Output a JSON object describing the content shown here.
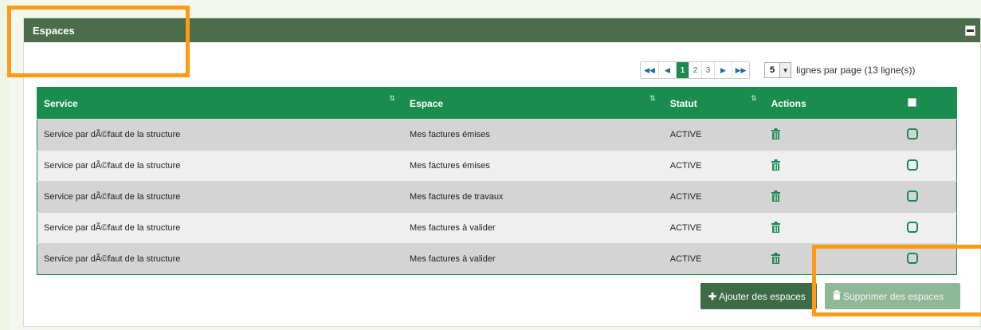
{
  "panel": {
    "title": "Espaces"
  },
  "pagination": {
    "first": "⏮",
    "prev": "◀",
    "pages": [
      "1",
      "2",
      "3"
    ],
    "active_page": "1",
    "next": "▶",
    "last": "⏭",
    "per_page_value": "5",
    "per_page_text": "lignes par page (13 ligne(s))"
  },
  "table": {
    "headers": {
      "service": "Service",
      "espace": "Espace",
      "statut": "Statut",
      "actions": "Actions"
    },
    "rows": [
      {
        "service": "Service par dÃ©faut de la structure",
        "espace": "Mes factures émises",
        "statut": "ACTIVE"
      },
      {
        "service": "Service par dÃ©faut de la structure",
        "espace": "Mes factures émises",
        "statut": "ACTIVE"
      },
      {
        "service": "Service par dÃ©faut de la structure",
        "espace": "Mes factures de travaux",
        "statut": "ACTIVE"
      },
      {
        "service": "Service par dÃ©faut de la structure",
        "espace": "Mes factures à valider",
        "statut": "ACTIVE"
      },
      {
        "service": "Service par dÃ©faut de la structure",
        "espace": "Mes factures à valider",
        "statut": "ACTIVE"
      }
    ]
  },
  "buttons": {
    "add_label": "Ajouter des espaces",
    "delete_label": "Supprimer des espaces"
  },
  "colors": {
    "header_bar": "#4b6d4b",
    "table_header": "#1a8c4e",
    "add_button": "#3d6b45",
    "delete_button": "#8fb896",
    "highlight": "#ff9a14"
  }
}
